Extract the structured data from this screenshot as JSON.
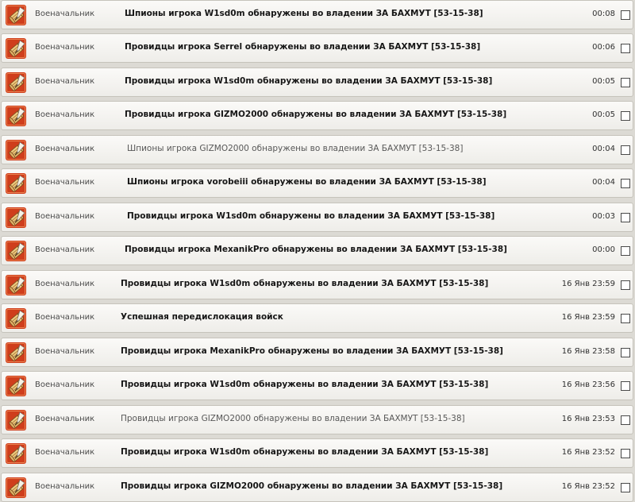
{
  "colors": {
    "background": "#dcdad4",
    "row_bg": "#f6f5f2",
    "row_border": "#c6c3bb",
    "icon_bg": "#cf3e1c"
  },
  "icon": "scroll-quill-icon",
  "messages": [
    {
      "sender": "Военачальник",
      "subject": "Шпионы игрока W1sd0m обнаружены во владении ЗА БАХМУТ [53-15-38]",
      "time": "00:08",
      "unread": true
    },
    {
      "sender": "Военачальник",
      "subject": "Провидцы игрока Serrel обнаружены во владении ЗА БАХМУТ [53-15-38]",
      "time": "00:06",
      "unread": true
    },
    {
      "sender": "Военачальник",
      "subject": "Провидцы игрока W1sd0m обнаружены во владении ЗА БАХМУТ [53-15-38]",
      "time": "00:05",
      "unread": true
    },
    {
      "sender": "Военачальник",
      "subject": "Провидцы игрока GIZMO2000 обнаружены во владении ЗА БАХМУТ [53-15-38]",
      "time": "00:05",
      "unread": true
    },
    {
      "sender": "Военачальник",
      "subject": "Шпионы игрока GIZMO2000 обнаружены во владении ЗА БАХМУТ [53-15-38]",
      "time": "00:04",
      "unread": false
    },
    {
      "sender": "Военачальник",
      "subject": "Шпионы игрока vorobeiii обнаружены во владении ЗА БАХМУТ [53-15-38]",
      "time": "00:04",
      "unread": true
    },
    {
      "sender": "Военачальник",
      "subject": "Провидцы игрока W1sd0m обнаружены во владении ЗА БАХМУТ [53-15-38]",
      "time": "00:03",
      "unread": true
    },
    {
      "sender": "Военачальник",
      "subject": "Провидцы игрока MexanikPro обнаружены во владении ЗА БАХМУТ [53-15-38]",
      "time": "00:00",
      "unread": true
    },
    {
      "sender": "Военачальник",
      "subject": "Провидцы игрока W1sd0m обнаружены во владении ЗА БАХМУТ [53-15-38]",
      "time": "16 Янв 23:59",
      "unread": true
    },
    {
      "sender": "Военачальник",
      "subject": "Успешная передислокация войск",
      "time": "16 Янв 23:59",
      "unread": true
    },
    {
      "sender": "Военачальник",
      "subject": "Провидцы игрока MexanikPro обнаружены во владении ЗА БАХМУТ [53-15-38]",
      "time": "16 Янв 23:58",
      "unread": true
    },
    {
      "sender": "Военачальник",
      "subject": "Провидцы игрока W1sd0m обнаружены во владении ЗА БАХМУТ [53-15-38]",
      "time": "16 Янв 23:56",
      "unread": true
    },
    {
      "sender": "Военачальник",
      "subject": "Провидцы игрока GIZMO2000 обнаружены во владении ЗА БАХМУТ [53-15-38]",
      "time": "16 Янв 23:53",
      "unread": false
    },
    {
      "sender": "Военачальник",
      "subject": "Провидцы игрока W1sd0m обнаружены во владении ЗА БАХМУТ [53-15-38]",
      "time": "16 Янв 23:52",
      "unread": true
    },
    {
      "sender": "Военачальник",
      "subject": "Провидцы игрока GIZMO2000 обнаружены во владении ЗА БАХМУТ [53-15-38]",
      "time": "16 Янв 23:52",
      "unread": true
    }
  ]
}
